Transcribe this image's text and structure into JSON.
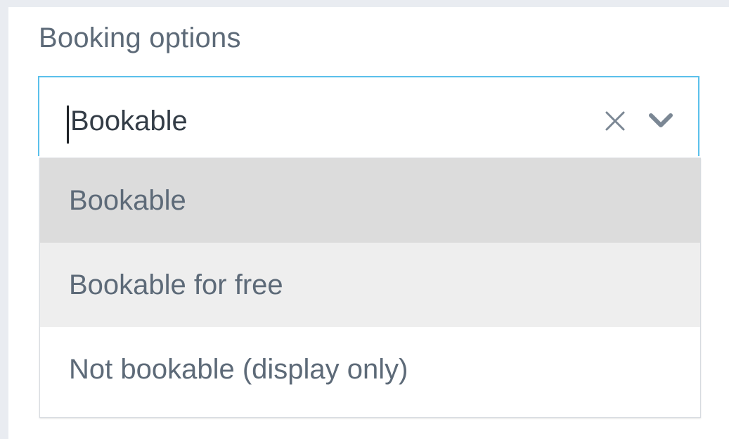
{
  "field": {
    "label": "Booking options",
    "value": "Bookable"
  },
  "icons": {
    "clear": "close-icon",
    "toggle": "chevron-down-icon"
  },
  "options": [
    {
      "label": "Bookable",
      "state": "selected"
    },
    {
      "label": "Bookable for free",
      "state": "hovered"
    },
    {
      "label": "Not bookable (display only)",
      "state": "default"
    }
  ],
  "colors": {
    "focus_border": "#5bc0eb",
    "selected_bg": "#dcdcdc",
    "hover_bg": "#eeeeee",
    "text": "#5d6a78"
  }
}
